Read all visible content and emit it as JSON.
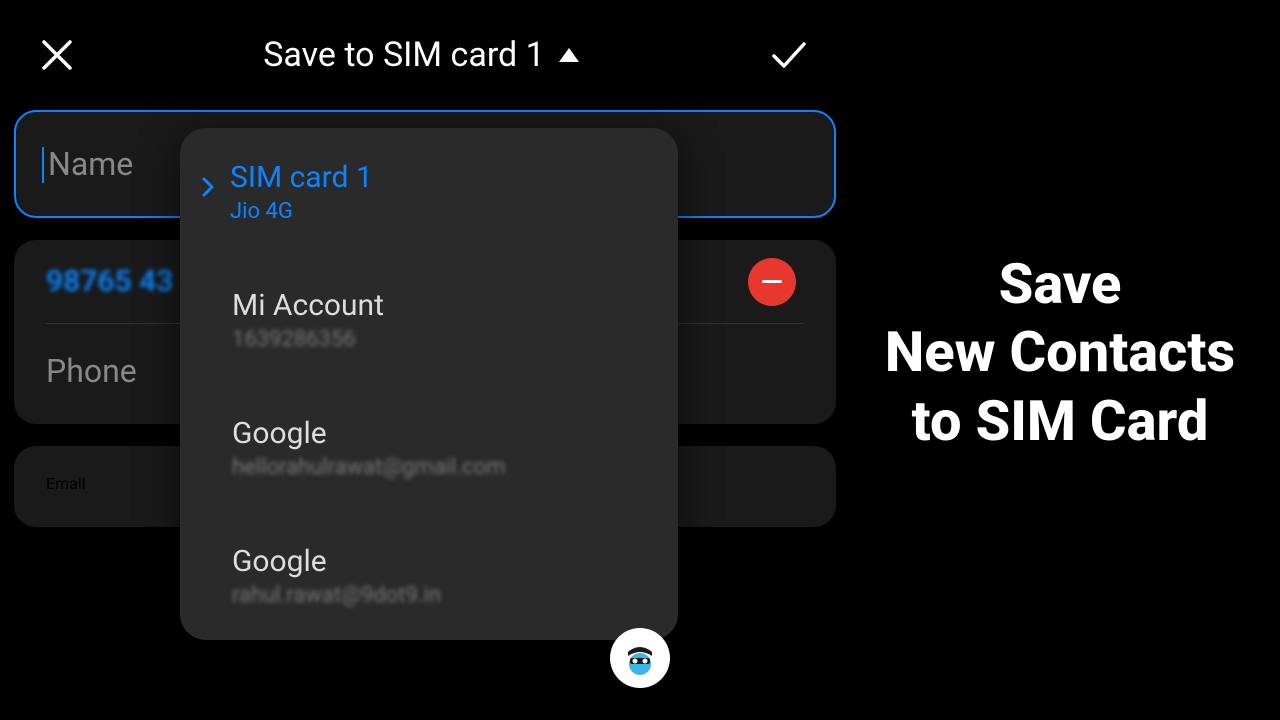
{
  "header": {
    "title": "Save to SIM card 1"
  },
  "fields": {
    "name_placeholder": "Name",
    "phone_value": "98765 43",
    "phone_label": "Phone",
    "email_label": "Email"
  },
  "dropdown": {
    "items": [
      {
        "title": "SIM card 1",
        "sub": "Jio 4G",
        "selected": true
      },
      {
        "title": "Mi Account",
        "sub": "1639286356",
        "blurred": true
      },
      {
        "title": "Google",
        "sub": "hellorahulrawat@gmail.com",
        "blurred": true
      },
      {
        "title": "Google",
        "sub": "rahul.rawat@9dot9.in",
        "blurred": true
      }
    ]
  },
  "caption": {
    "line1": "Save",
    "line2": "New Contacts",
    "line3": "to SIM Card"
  },
  "colors": {
    "accent": "#0a84ff",
    "danger": "#e8382e"
  }
}
